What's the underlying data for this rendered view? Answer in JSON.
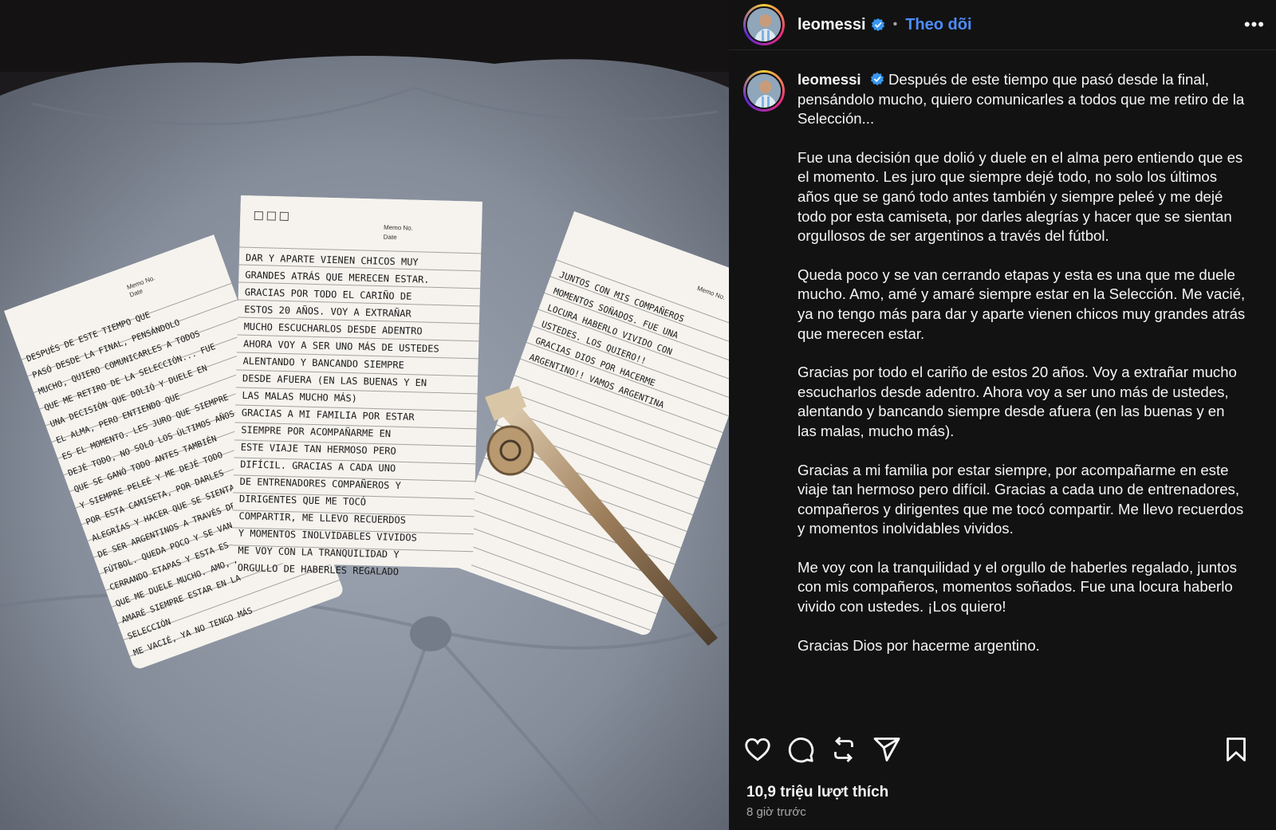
{
  "post": {
    "username": "leomessi",
    "separator": "•",
    "follow_label": "Theo dõi",
    "more_label": "•••",
    "caption_paragraphs": [
      "Después de este tiempo que pasó desde la final, pensándolo mucho, quiero comunicarles a todos que me retiro de la Selección...",
      "Fue una decisión que dolió y duele en el alma pero entiendo que es el momento. Les juro que siempre dejé todo, no solo los últimos años que se ganó todo antes también y siempre peleé y me dejé todo por esta camiseta, por darles alegrías y hacer que se sientan orgullosos de ser argentinos a través del fútbol.",
      "Queda poco y se van cerrando etapas y esta es una que me duele mucho. Amo, amé y amaré siempre estar en la Selección. Me vacié, ya no tengo más para dar y aparte vienen chicos muy grandes atrás que merecen estar.",
      "Gracias por todo el cariño de estos 20 años. Voy a extrañar mucho escucharlos desde adentro. Ahora voy a ser uno más de ustedes, alentando y bancando siempre desde afuera (en las buenas y en las malas, mucho más).",
      "Gracias a mi familia por estar siempre, por acompañarme en este viaje tan hermoso pero difícil. Gracias a cada uno de entrenadores, compañeros y dirigentes que me tocó compartir. Me llevo recuerdos y momentos inolvidables vividos.",
      "Me voy con la tranquilidad y el orgullo de haberles regalado, juntos con mis compañeros, momentos soñados. Fue una locura haberlo vivido con ustedes. ¡Los quiero!",
      "Gracias Dios por hacerme argentino."
    ],
    "likes": "10,9 triệu lượt thích",
    "time_ago": "8 giờ trước"
  },
  "icons": [
    "heart-icon",
    "comment-icon",
    "repost-icon",
    "share-icon",
    "bookmark-icon",
    "verified-icon",
    "more-icon"
  ],
  "colors": {
    "accent": "#4c8dff",
    "verified": "#3897f0",
    "background": "#121212"
  },
  "photo": {
    "memo_no_label": "Memo No.",
    "date_label": "Date",
    "note_left_lines": [
      "DESPUÉS DE ESTE TIEMPO QUE",
      "PASÓ DESDE LA FINAL, PENSÁNDOLO",
      "MUCHO, QUIERO COMUNICARLES A TODOS",
      "QUE ME RETIRO DE LA SELECCIÓN... FUE",
      "UNA DECISIÓN QUE DOLIÓ Y DUELE EN",
      "EL ALMA, PERO ENTIENDO QUE",
      "ES EL MOMENTO. LES JURO QUE SIEMPRE",
      "DEJÉ TODO, NO SOLO LOS ÚLTIMOS AÑOS",
      "QUE SE GANÓ TODO ANTES TAMBIÉN",
      "Y SIEMPRE PELEÉ Y ME DEJÉ TODO",
      "POR ESTA CAMISETA, POR DARLES",
      "ALEGRÍAS Y HACER QUE SE SIENTAN ORGULLOSOS",
      "DE SER ARGENTINOS A TRAVÉS DEL",
      "FÚTBOL. QUEDA POCO Y SE VAN",
      "CERRANDO ETAPAS Y ESTA ES UNA",
      "QUE ME DUELE MUCHO. AMO, AMÉ Y",
      "AMARÉ SIEMPRE ESTAR EN LA",
      "SELECCIÓN",
      "ME VACIÉ, YA NO TENGO MÁS"
    ],
    "note_middle_lines": [
      "DAR Y APARTE VIENEN CHICOS MUY",
      "GRANDES ATRÁS QUE MERECEN ESTAR.",
      "GRACIAS POR TODO EL CARIÑO DE",
      "ESTOS 20 AÑOS. VOY A EXTRAÑAR",
      "MUCHO ESCUCHARLOS DESDE ADENTRO",
      "AHORA VOY A SER UNO MÁS DE USTEDES",
      "ALENTANDO Y BANCANDO SIEMPRE",
      "DESDE AFUERA (EN LAS BUENAS Y EN",
      "LAS MALAS MUCHO MÁS)",
      "GRACIAS A MI FAMILIA POR ESTAR",
      "SIEMPRE POR ACOMPAÑARME EN",
      "ESTE VIAJE TAN HERMOSO PERO",
      "DIFÍCIL. GRACIAS A CADA UNO",
      "DE ENTRENADORES COMPAÑEROS Y",
      "DIRIGENTES QUE ME TOCÓ",
      "COMPARTIR, ME LLEVO RECUERDOS",
      "Y MOMENTOS INOLVIDABLES VIVIDOS",
      "ME VOY CON LA TRANQUILIDAD Y",
      "ORGULLO DE HABERLES REGALADO"
    ],
    "note_right_lines": [
      "JUNTOS CON MIS COMPAÑEROS",
      "MOMENTOS SOÑADOS. FUE UNA",
      "LOCURA HABERLO VIVIDO CON",
      "USTEDES. LOS QUIERO!!",
      "GRACIAS DIOS POR HACERME",
      "ARGENTINO!! VAMOS ARGENTINA"
    ]
  }
}
